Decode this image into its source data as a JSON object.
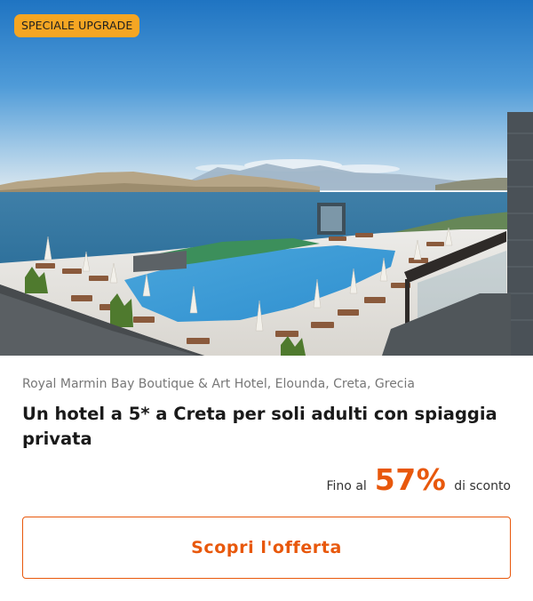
{
  "badge": {
    "label": "SPECIALE UPGRADE"
  },
  "hotel": {
    "location": "Royal Marmin Bay Boutique & Art Hotel, Elounda, Creta, Grecia",
    "title": "Un hotel a 5* a Creta per soli adulti con spiaggia privata"
  },
  "discount": {
    "prefix": "Fino al",
    "value": "57%",
    "suffix": "di sconto"
  },
  "cta": {
    "label": "Scopri l'offerta"
  },
  "colors": {
    "accent": "#e8580c",
    "badge_bg": "#f5a623"
  }
}
